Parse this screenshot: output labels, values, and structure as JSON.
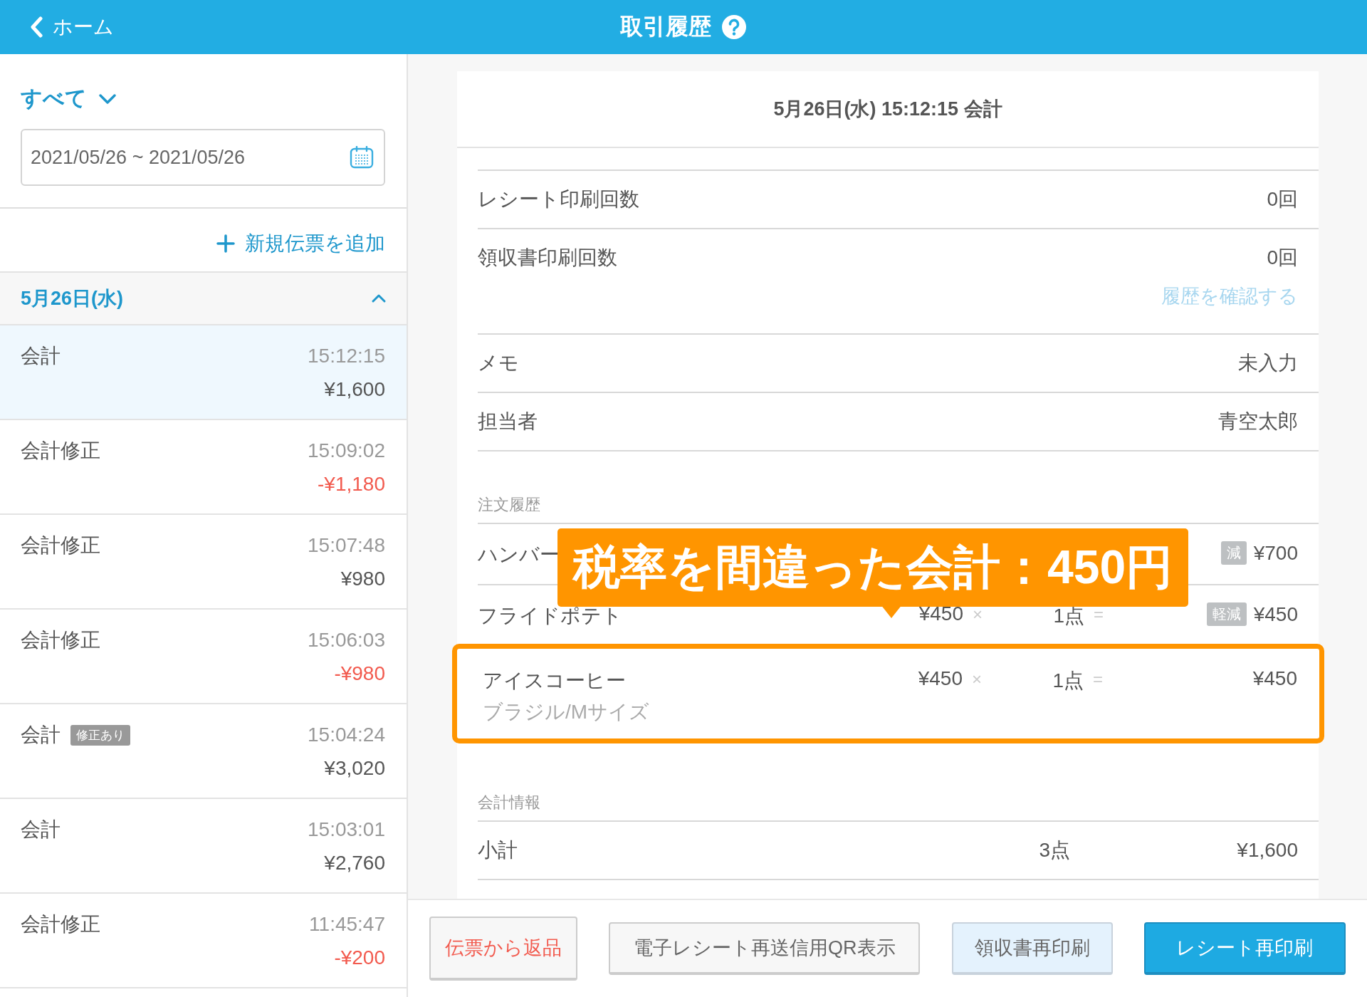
{
  "header": {
    "back_label": "ホーム",
    "title": "取引履歴"
  },
  "sidebar": {
    "filter": "すべて",
    "date_range": "2021/05/26 ~ 2021/05/26",
    "add_label": "新規伝票を追加",
    "group": {
      "label": "5月26日(水)",
      "expanded": true
    },
    "transactions": [
      {
        "type": "会計",
        "time": "15:12:15",
        "amount": "¥1,600",
        "negative": false,
        "selected": true
      },
      {
        "type": "会計修正",
        "time": "15:09:02",
        "amount": "-¥1,180",
        "negative": true,
        "selected": false
      },
      {
        "type": "会計修正",
        "time": "15:07:48",
        "amount": "¥980",
        "negative": false,
        "selected": false
      },
      {
        "type": "会計修正",
        "time": "15:06:03",
        "amount": "-¥980",
        "negative": true,
        "selected": false
      },
      {
        "type": "会計",
        "tag": "修正あり",
        "time": "15:04:24",
        "amount": "¥3,020",
        "negative": false,
        "selected": false
      },
      {
        "type": "会計",
        "time": "15:03:01",
        "amount": "¥2,760",
        "negative": false,
        "selected": false
      },
      {
        "type": "会計修正",
        "time": "11:45:47",
        "amount": "-¥200",
        "negative": true,
        "selected": false
      }
    ]
  },
  "detail": {
    "title": "5月26日(水) 15:12:15 会計",
    "info_rows": [
      {
        "label": "レシート印刷回数",
        "value": "0回"
      },
      {
        "label": "領収書印刷回数",
        "value": "0回",
        "link": "履歴を確認する"
      },
      {
        "label": "メモ",
        "value": "未入力"
      },
      {
        "label": "担当者",
        "value": "青空太郎"
      }
    ],
    "order_section": "注文履歴",
    "orders": [
      {
        "name": "ハンバー",
        "tax_tag": "減",
        "total": "¥700",
        "highlighted": false
      },
      {
        "name": "フライドポテト",
        "price": "¥450",
        "times": "×",
        "qty": "1点",
        "equals": "=",
        "tax_tag": "軽減",
        "total": "¥450",
        "highlighted": false
      },
      {
        "name": "アイスコーヒー",
        "option": "ブラジル/Mサイズ",
        "price": "¥450",
        "times": "×",
        "qty": "1点",
        "equals": "=",
        "total": "¥450",
        "highlighted": true
      }
    ],
    "callout": "税率を間違った会計：450円",
    "accounting_section": "会計情報",
    "subtotal": {
      "label": "小計",
      "qty": "3点",
      "total": "¥1,600"
    }
  },
  "buttons": [
    {
      "label": "伝票から返品",
      "kind": "danger"
    },
    {
      "label": "電子レシート再送信用QR表示",
      "kind": "default"
    },
    {
      "label": "領収書再印刷",
      "kind": "light"
    },
    {
      "label": "レシート再印刷",
      "kind": "primary"
    }
  ]
}
